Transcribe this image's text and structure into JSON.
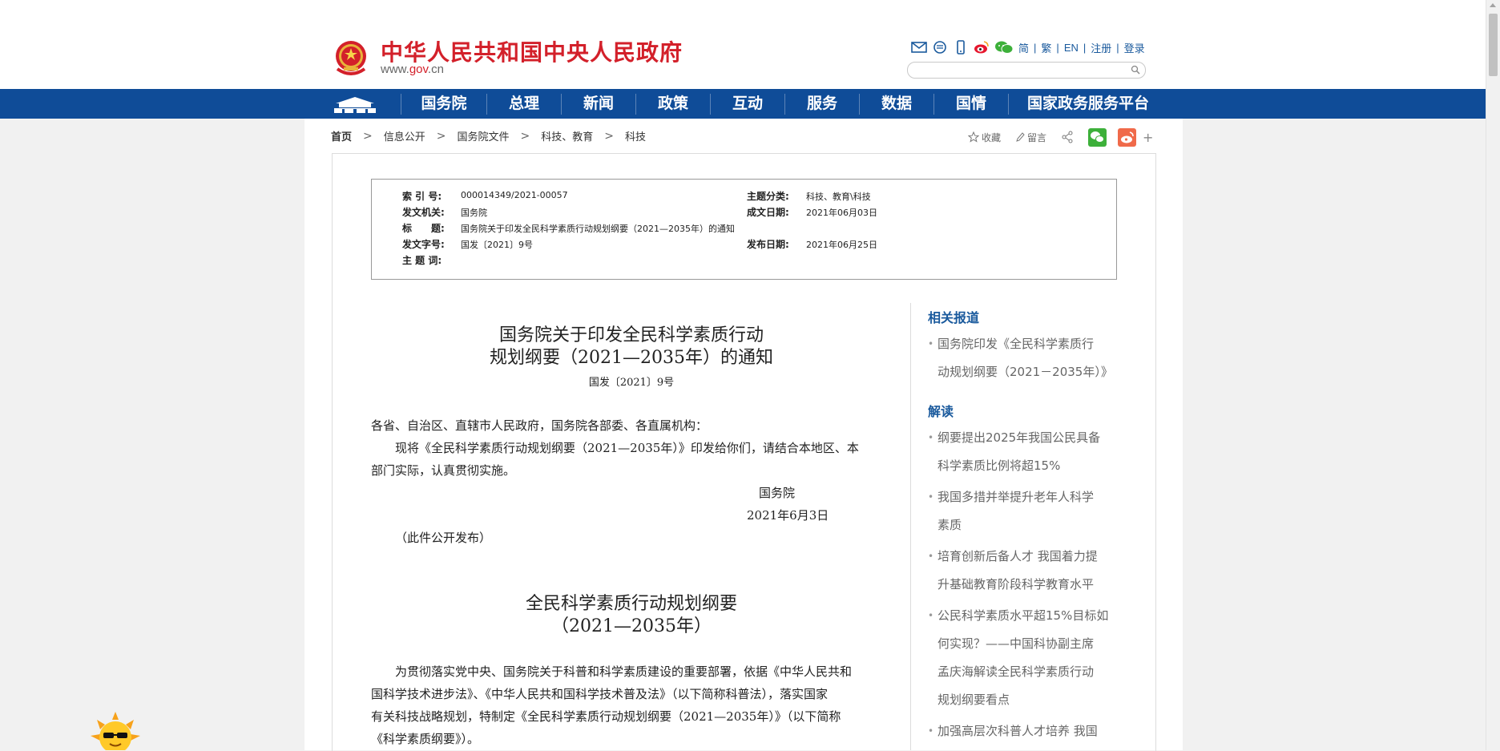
{
  "header": {
    "site_title": "中华人民共和国中央人民政府",
    "site_url_prefix": "www.",
    "site_url_gov": "gov",
    "site_url_suffix": ".cn",
    "links": [
      "简",
      "繁",
      "EN",
      "注册",
      "登录"
    ],
    "icons": [
      "mail-icon",
      "chat-icon",
      "mobile-icon",
      "weibo-icon",
      "wechat-icon"
    ],
    "search_placeholder": ""
  },
  "nav": {
    "items": [
      "国务院",
      "总理",
      "新闻",
      "政策",
      "互动",
      "服务",
      "数据",
      "国情",
      "国家政务服务平台"
    ]
  },
  "breadcrumb": [
    "首页",
    "信息公开",
    "国务院文件",
    "科技、教育",
    "科技"
  ],
  "tools": {
    "favorite": "收藏",
    "comment": "留言"
  },
  "info": {
    "index_label": "索 引 号:",
    "index_value": "000014349/2021-00057",
    "topic_label": "主题分类:",
    "topic_value": "科技、教育\\科技",
    "issuer_label": "发文机关:",
    "issuer_value": "国务院",
    "written_label": "成文日期:",
    "written_value": "2021年06月03日",
    "title_label": "标　　题:",
    "title_value": "国务院关于印发全民科学素质行动规划纲要（2021—2035年）的通知",
    "doc_no_label": "发文字号:",
    "doc_no_value": "国发〔2021〕9号",
    "publish_label": "发布日期:",
    "publish_value": "2021年06月25日",
    "keywords_label": "主 题 词:",
    "keywords_value": ""
  },
  "article": {
    "title_line1": "国务院关于印发全民科学素质行动",
    "title_line2": "规划纲要（2021—2035年）的通知",
    "doc_number": "国发〔2021〕9号",
    "salutation": "各省、自治区、直辖市人民政府，国务院各部委、各直属机构：",
    "body_line1": "　　现将《全民科学素质行动规划纲要（2021—2035年）》印发给你们，请结合本地区、本",
    "body_line2": "部门实际，认真贯彻实施。",
    "signer": "国务院",
    "date": "2021年6月3日",
    "note": "（此件公开发布）",
    "plan_title_line1": "全民科学素质行动规划纲要",
    "plan_title_line2": "（2021—2035年）",
    "plan_p1": "　　为贯彻落实党中央、国务院关于科普和科学素质建设的重要部署，依据《中华人民共和",
    "plan_p2": "国科学技术进步法》、《中华人民共和国科学技术普及法》（以下简称科普法），落实国家",
    "plan_p3": "有关科技战略规划，特制定《全民科学素质行动规划纲要（2021—2035年）》（以下简称",
    "plan_p4": "《科学素质纲要》）。"
  },
  "sidebar": {
    "related_heading": "相关报道",
    "related_items": [
      {
        "line1": "国务院印发《全民科学素质行",
        "line2": "动规划纲要（2021－2035年）》"
      }
    ],
    "interp_heading": "解读",
    "interp_items": [
      {
        "line1": "纲要提出2025年我国公民具备",
        "line2": "科学素质比例将超15%"
      },
      {
        "line1": "我国多措并举提升老年人科学",
        "line2": "素质"
      },
      {
        "line1": "培育创新后备人才  我国着力提",
        "line2": "升基础教育阶段科学教育水平"
      },
      {
        "line1": "公民科学素质水平超15%目标如",
        "line2": "何实现？——中国科协副主席",
        "line3": "孟庆海解读全民科学素质行动",
        "line4": "规划纲要看点"
      },
      {
        "line1": "加强高层次科普人才培养  我国"
      }
    ]
  },
  "colors": {
    "brand_red": "#d3202a",
    "nav_blue": "#0f4c98",
    "link_blue": "#1a5a9d"
  }
}
